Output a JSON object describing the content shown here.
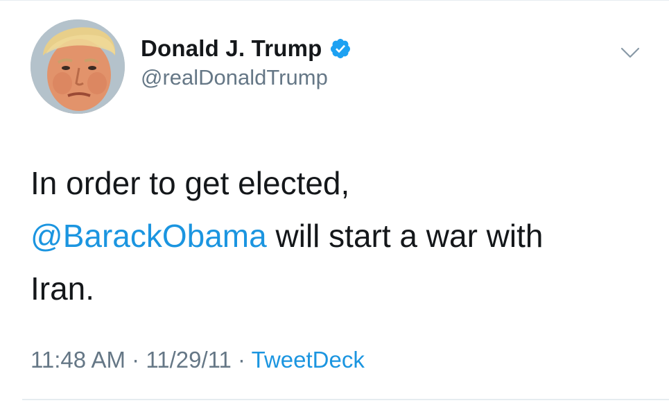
{
  "tweet": {
    "author": {
      "display_name": "Donald J. Trump",
      "handle": "@realDonaldTrump",
      "verified": true,
      "verified_icon": "verified-badge-icon"
    },
    "menu_icon": "chevron-down-icon",
    "body": {
      "line1": "In order to get elected,",
      "mention": "@BarackObama",
      "line2_rest": " will start a war with",
      "line3": "Iran."
    },
    "meta": {
      "time": "11:48 AM",
      "sep1": " · ",
      "date": "11/29/11",
      "sep2": " · ",
      "source": "TweetDeck"
    }
  },
  "colors": {
    "link": "#1b95e0",
    "secondary_text": "#657786",
    "primary_text": "#14171a",
    "verified": "#1da1f2",
    "divider": "#e6ecf0"
  }
}
